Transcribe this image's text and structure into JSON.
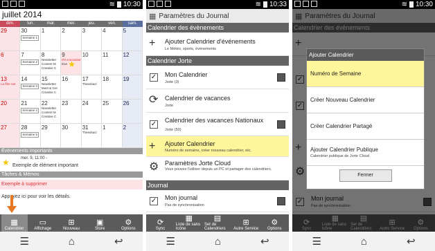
{
  "screens": [
    {
      "status_time": "10:30",
      "calendar": {
        "title": "juillet 2014",
        "days_of_week": [
          "dim.",
          "lun.",
          "mar.",
          "mer.",
          "jeu.",
          "ven.",
          "sam."
        ],
        "week1": [
          "29",
          "30",
          "1",
          "2",
          "3",
          "4",
          "5"
        ],
        "week2": [
          "6",
          "7",
          "8",
          "9",
          "10",
          "11",
          "12"
        ],
        "week3": [
          "13",
          "14",
          "15",
          "16",
          "17",
          "18",
          "19"
        ],
        "week4": [
          "20",
          "21",
          "22",
          "23",
          "24",
          "25",
          "26"
        ],
        "week5": [
          "27",
          "28",
          "29",
          "30",
          "31",
          "1",
          "2"
        ],
        "events": {
          "semaine_1": "Semaine 1",
          "semaine_2": "Semaine 2",
          "semaine_3": "Semaine 3",
          "semaine_4": "Semaine 4",
          "semaine_5": "Semaine 5",
          "newsletter": "Newsletter",
          "content_m": "Content M",
          "creative_c": "Creative C",
          "meet_greet": "Meet & Gre",
          "theedsac": "Theedsacl",
          "ifa": "IFA Innovations medi",
          "exe": "Exe",
          "la_fete_nat": "La fête nat"
        }
      },
      "sections": {
        "important": "Événements importants",
        "important_date": "mer. 9, 11:00 -",
        "important_text": "Exemple de élément important",
        "taches": "Tâches & Mémos",
        "taches_item": "Exemple à supprimer",
        "hint": "Appuyez ici pour voir les détails."
      },
      "toolbar": [
        "Calendrier",
        "Affichage",
        "Nouveau",
        "Store",
        "Options"
      ]
    },
    {
      "status_time": "10:33",
      "title": "Paramètres du Journal",
      "section_events": "Calendrier des évènements",
      "add_events_title": "Ajouter Calendrier d'événements",
      "add_events_sub": "Le Météo, sports, événements",
      "section_jorte": "Calendrier Jorte",
      "items": [
        {
          "title": "Mon Calendrier",
          "sub": "Jorte (3)"
        },
        {
          "title": "Calendrier de vacances",
          "sub": "Jorte"
        },
        {
          "title": "Calendrier des vacances Nationaux",
          "sub": "Jorte (50)"
        }
      ],
      "add_cal_title": "Ajouter Calendrier",
      "add_cal_sub": "Numéro de semaine, créer nouveau calendrier, etc.",
      "cloud_title": "Paramètres Jorte Cloud",
      "cloud_sub": "Vous pouvez l'utiliser depuis un PC et partager des calendriers.",
      "section_journal": "Journal",
      "journal_title": "Mon journal",
      "journal_sub": "Pas de synchronisation",
      "toolbar": [
        "Sync",
        "Liste de sans Icône",
        "Set de Calendriers",
        "Autre Service",
        "Options"
      ]
    },
    {
      "status_time": "10:30",
      "dialog": {
        "title": "Ajouter Calendrier",
        "options": [
          {
            "label": "Numéro de Semaine",
            "sub": ""
          },
          {
            "label": "Créer Nouveau Calendrier",
            "sub": ""
          },
          {
            "label": "Créer Calendrier Partagé",
            "sub": ""
          },
          {
            "label": "Ajouter Calendrier Publique",
            "sub": "Calendrier publique de Jorte Cloud"
          }
        ],
        "close_label": "Fermer"
      }
    }
  ],
  "colors": {
    "highlight": "#fff59a",
    "section_dark": "#636363",
    "arrow": "#e87722",
    "sunday": "#fbe3e7",
    "saturday": "#e6ebf6"
  }
}
